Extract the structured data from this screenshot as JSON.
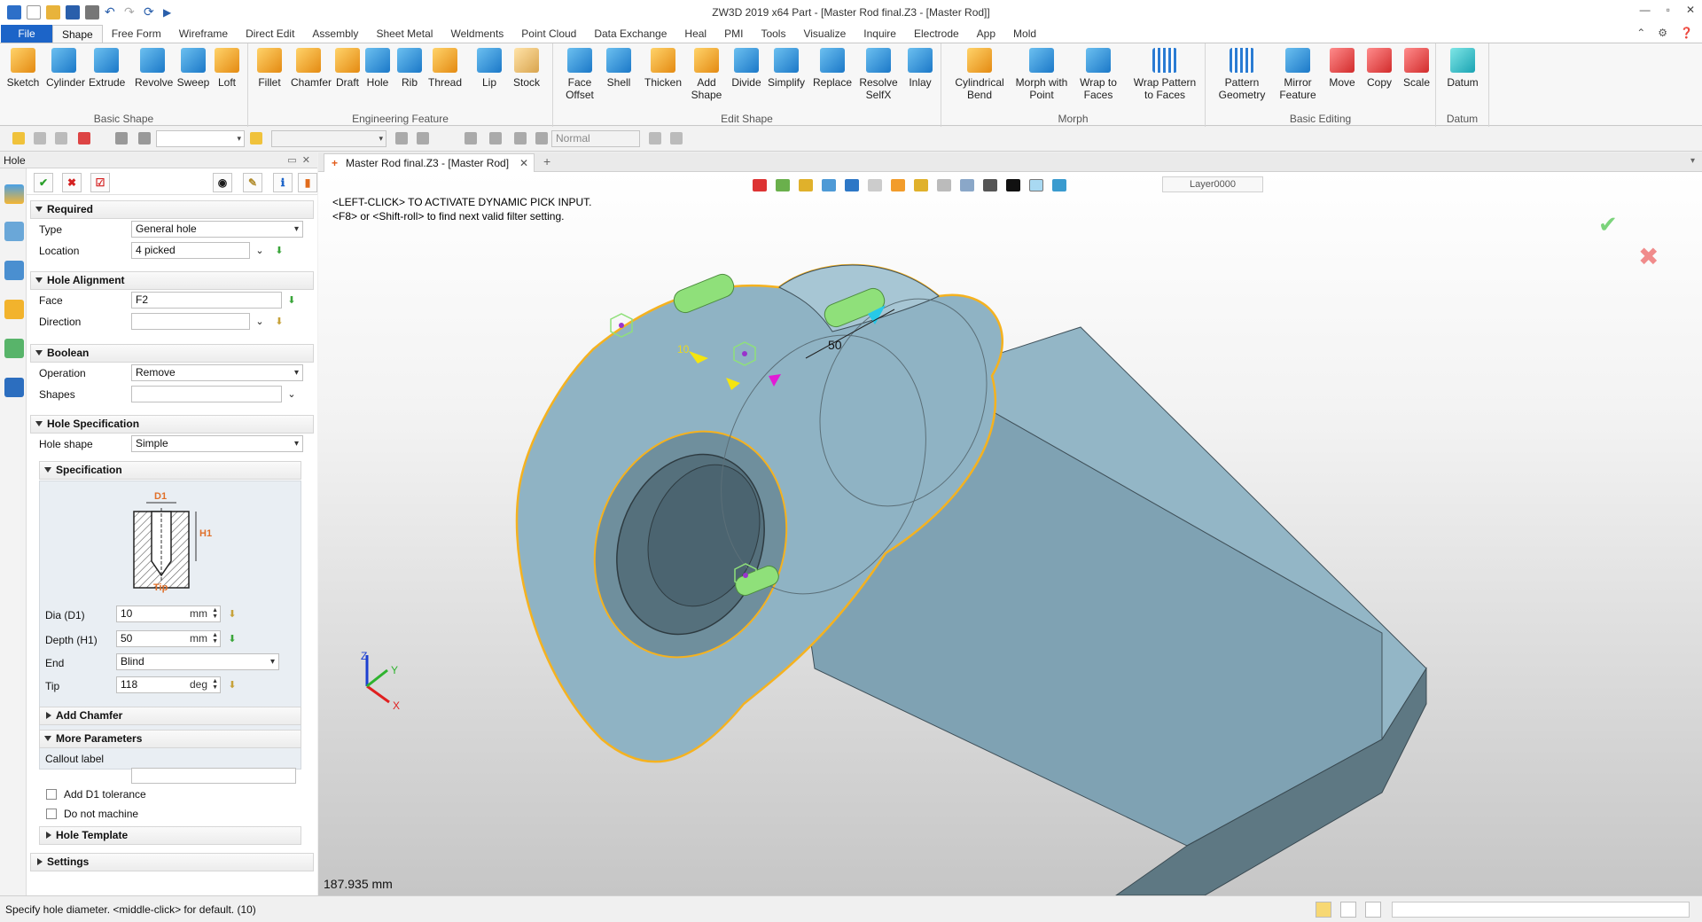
{
  "window": {
    "title": "ZW3D 2019  x64       Part - [Master Rod final.Z3 - [Master Rod]]",
    "controls": [
      "—",
      "▫",
      "✕"
    ]
  },
  "menu": {
    "file": "File",
    "tabs": [
      "Shape",
      "Free Form",
      "Wireframe",
      "Direct Edit",
      "Assembly",
      "Sheet Metal",
      "Weldments",
      "Point Cloud",
      "Data Exchange",
      "Heal",
      "PMI",
      "Tools",
      "Visualize",
      "Inquire",
      "Electrode",
      "App",
      "Mold"
    ],
    "active_tab": "Shape"
  },
  "ribbon": {
    "groups": [
      {
        "name": "Basic Shape",
        "buttons": [
          "Sketch",
          "Cylinder",
          "Extrude",
          "Revolve",
          "Sweep",
          "Loft"
        ]
      },
      {
        "name": "Engineering Feature",
        "buttons": [
          "Fillet",
          "Chamfer",
          "Draft",
          "Hole",
          "Rib",
          "Thread",
          "Lip",
          "Stock"
        ]
      },
      {
        "name": "Edit Shape",
        "buttons": [
          "Face Offset",
          "Shell",
          "Thicken",
          "Add Shape",
          "Divide",
          "Simplify",
          "Replace",
          "Resolve SelfX",
          "Inlay"
        ]
      },
      {
        "name": "Morph",
        "buttons": [
          "Cylindrical Bend",
          "Morph with Point",
          "Wrap to Faces",
          "Wrap Pattern to Faces"
        ]
      },
      {
        "name": "Basic Editing",
        "buttons": [
          "Pattern Geometry",
          "Mirror Feature",
          "Move",
          "Copy",
          "Scale"
        ]
      },
      {
        "name": "Datum",
        "buttons": [
          "Datum"
        ]
      }
    ]
  },
  "toolbar2": {
    "render_mode": "Normal"
  },
  "panel": {
    "title": "Hole",
    "sections": {
      "required": {
        "title": "Required",
        "type_label": "Type",
        "type_value": "General hole",
        "location_label": "Location",
        "location_value": "4 picked"
      },
      "alignment": {
        "title": "Hole Alignment",
        "face_label": "Face",
        "face_value": "F2",
        "direction_label": "Direction",
        "direction_value": ""
      },
      "boolean": {
        "title": "Boolean",
        "operation_label": "Operation",
        "operation_value": "Remove",
        "shapes_label": "Shapes",
        "shapes_value": ""
      },
      "spec": {
        "title": "Hole Specification",
        "shape_label": "Hole shape",
        "shape_value": "Simple",
        "sub_title": "Specification",
        "diagram": {
          "d1": "D1",
          "h1": "H1",
          "tip": "Tip"
        },
        "dia_label": "Dia (D1)",
        "dia_value": "10",
        "dia_unit": "mm",
        "depth_label": "Depth (H1)",
        "depth_value": "50",
        "depth_unit": "mm",
        "end_label": "End",
        "end_value": "Blind",
        "tip_label": "Tip",
        "tip_value": "118",
        "tip_unit": "deg"
      },
      "chamfer": {
        "title": "Add Chamfer"
      },
      "more": {
        "title": "More Parameters",
        "callout_label": "Callout label",
        "callout_value": "",
        "tol_label": "Add D1 tolerance",
        "nomachine_label": "Do not machine"
      },
      "template": {
        "title": "Hole Template"
      },
      "settings": {
        "title": "Settings"
      }
    }
  },
  "document": {
    "tab_label": "Master Rod final.Z3 - [Master Rod]",
    "layer": "Layer0000"
  },
  "viewport": {
    "msg_line1": "<LEFT-CLICK> TO ACTIVATE DYNAMIC PICK INPUT.",
    "msg_line2": "<F8> or <Shift-roll> to find next valid filter setting.",
    "dim_depth": "50",
    "dim_dia": "10",
    "measure": "187.935 mm",
    "axes": {
      "x": "X",
      "y": "Y",
      "z": "Z"
    }
  },
  "status": {
    "message": "Specify hole diameter.   <middle-click> for default. (10)"
  },
  "colors": {
    "file_tab": "#1c64c8",
    "model_body": "#8fb3c4",
    "highlight": "#f5b21f",
    "pins": "#8fe07a"
  }
}
